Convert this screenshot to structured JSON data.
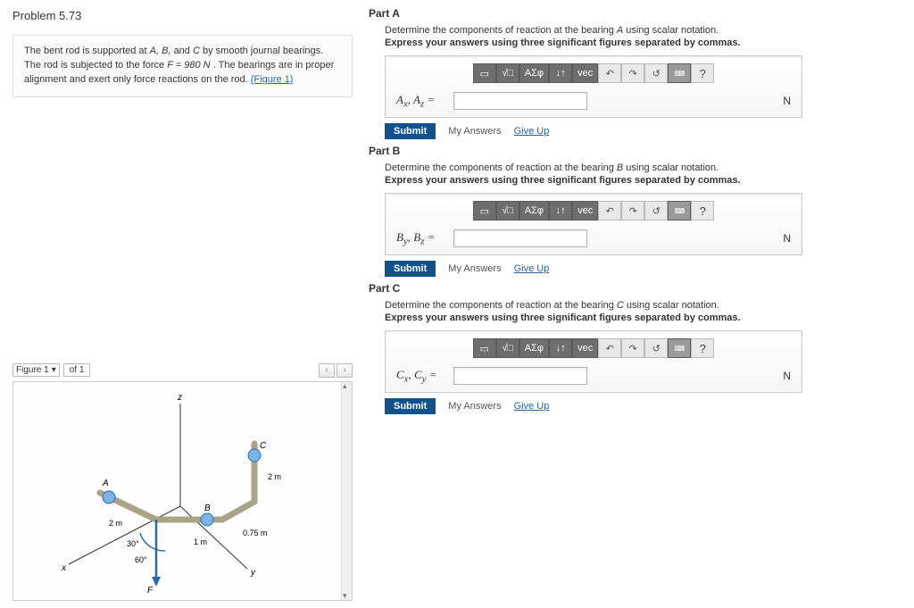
{
  "problem": {
    "number": "Problem 5.73",
    "statement_pre": "The bent rod is supported at ",
    "pts": "A, B,",
    "and": " and ",
    "ptC": "C",
    "statement_mid": " by smooth journal bearings. The rod is subjected to the force ",
    "force": "F = 980 N",
    "statement_post": ". The bearings are in proper alignment and exert only force reactions on the rod. ",
    "figure_link": "(Figure 1)"
  },
  "figure_nav": {
    "label": "Figure 1",
    "of": "of 1",
    "prev": "‹",
    "next": "›"
  },
  "figure": {
    "z": "z",
    "x": "x",
    "y": "y",
    "A": "A",
    "B": "B",
    "C": "C",
    "F": "F",
    "d2m_a": "2 m",
    "d2m_b": "2 m",
    "d1m": "1 m",
    "d075": "0.75 m",
    "a30": "30°",
    "a60": "60°"
  },
  "toolbar": {
    "t1": "▭",
    "t2": "√□",
    "t3": "ΑΣφ",
    "t4": "↓↑",
    "t5": "vec",
    "t6": "↶",
    "t7": "↷",
    "t8": "↺",
    "t9": "⌨",
    "t10": "?"
  },
  "parts": [
    {
      "title": "Part A",
      "desc_pre": "Determine the components of reaction at the bearing ",
      "bearing": "A",
      "desc_post": " using scalar notation.",
      "instr": "Express your answers using three significant figures separated by commas.",
      "label": "A_x, A_z =",
      "unit": "N"
    },
    {
      "title": "Part B",
      "desc_pre": "Determine the components of reaction at the bearing ",
      "bearing": "B",
      "desc_post": " using scalar notation.",
      "instr": "Express your answers using three significant figures separated by commas.",
      "label": "B_y, B_z =",
      "unit": "N"
    },
    {
      "title": "Part C",
      "desc_pre": "Determine the components of reaction at the bearing ",
      "bearing": "C",
      "desc_post": " using scalar notation.",
      "instr": "Express your answers using three significant figures separated by commas.",
      "label": "C_x, C_y =",
      "unit": "N"
    }
  ],
  "buttons": {
    "submit": "Submit",
    "my_answers": "My Answers",
    "give_up": "Give Up"
  }
}
